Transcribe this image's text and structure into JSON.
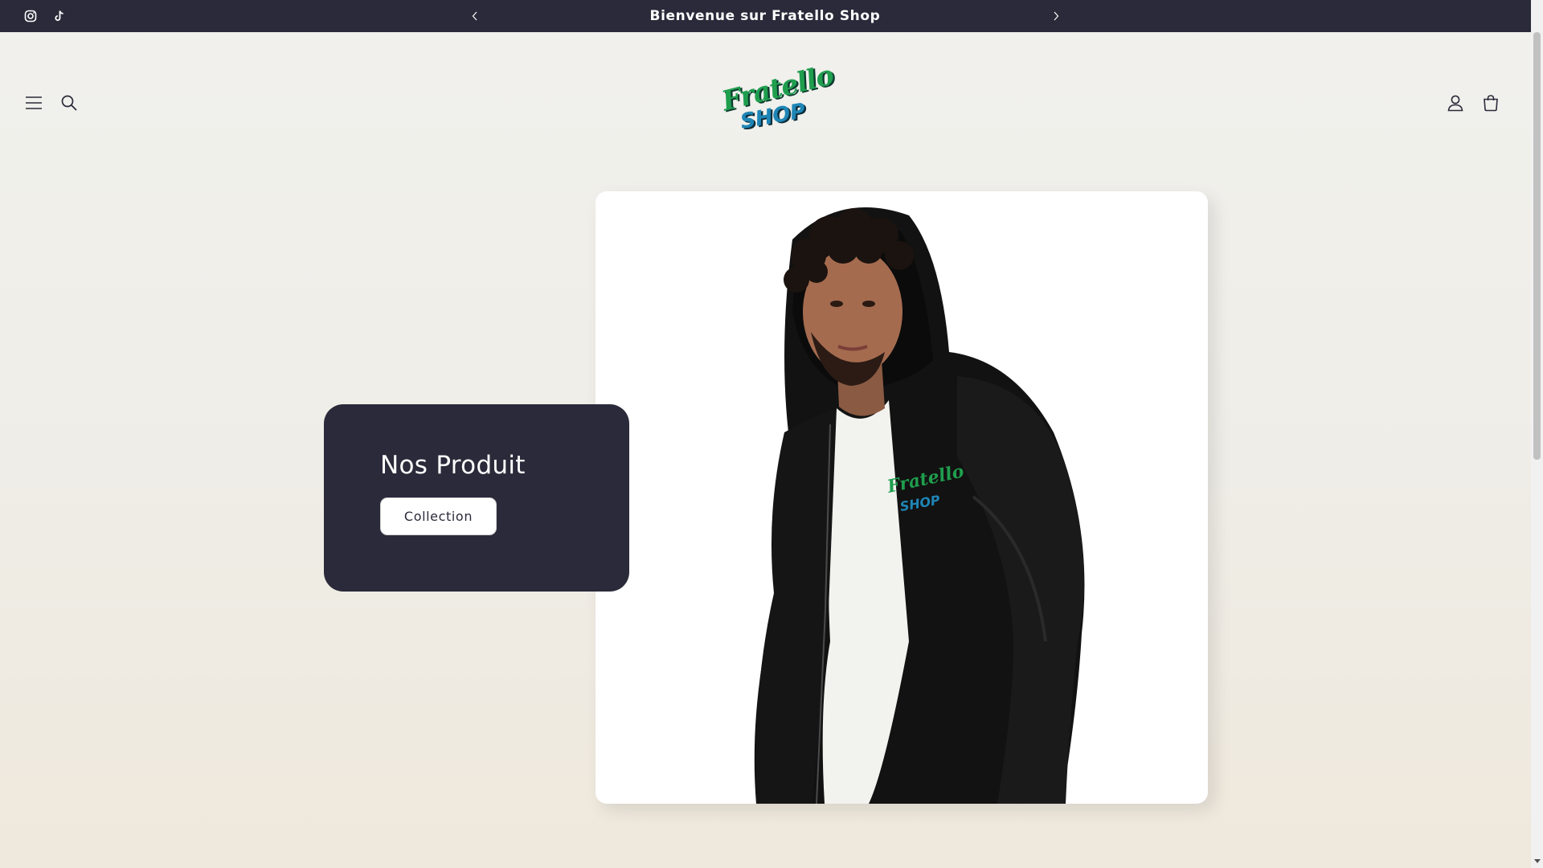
{
  "announcement": {
    "text": "Bienvenue sur Fratello Shop",
    "social": [
      "instagram-icon",
      "tiktok-icon"
    ],
    "prev_icon": "chevron-left-icon",
    "next_icon": "chevron-right-icon",
    "background": "#2b2a3a"
  },
  "header": {
    "menu_icon": "hamburger-menu-icon",
    "search_icon": "search-icon",
    "account_icon": "account-icon",
    "cart_icon": "cart-icon",
    "logo": {
      "line1": "Fratello",
      "line2": "SHOP",
      "green": "#1f9e4e",
      "blue": "#1e86b6"
    }
  },
  "hero": {
    "title": "Nos Produit",
    "button_label": "Collection",
    "card_color": "#2b2a3a",
    "image": {
      "chest_logo_line1": "Fratello",
      "chest_logo_line2": "SHOP"
    }
  }
}
